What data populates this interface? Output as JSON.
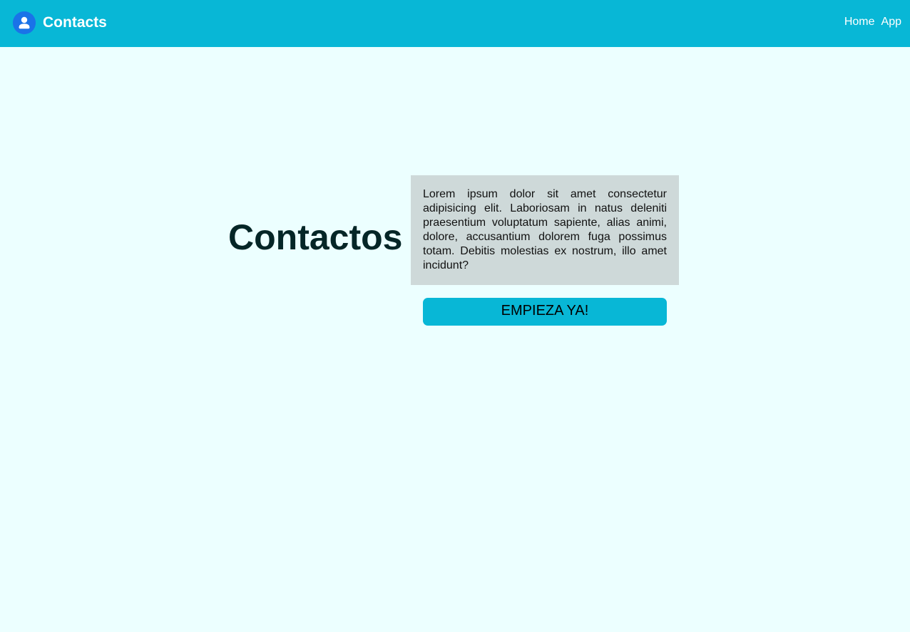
{
  "navbar": {
    "brand_icon": "user-icon",
    "brand_title": "Contacts",
    "links": [
      "Home",
      "App"
    ]
  },
  "main": {
    "title": "Contactos",
    "description": "Lorem ipsum dolor sit amet consectetur adipisicing elit. Laboriosam in natus deleniti praesentium voluptatum sapiente, alias animi, dolore, accusantium dolorem fuga possimus totam. Debitis molestias ex nostrum, illo amet incidunt?",
    "cta_label": "EMPIEZA YA!"
  },
  "colors": {
    "navbar": "#08b7d6",
    "background": "#ecffff",
    "brand_icon": "#1a73e8",
    "description_box": "#ced9d9",
    "title_text": "#052627"
  }
}
